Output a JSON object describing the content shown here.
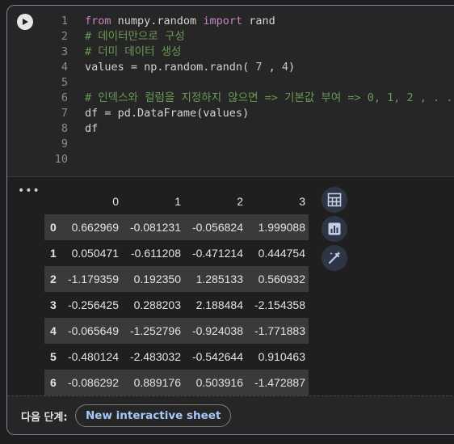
{
  "editor": {
    "lines": [
      {
        "n": "1",
        "segments": [
          {
            "t": "from",
            "c": "kw"
          },
          {
            "t": " numpy.random ",
            "c": ""
          },
          {
            "t": "import",
            "c": "kw"
          },
          {
            "t": " rand",
            "c": ""
          }
        ]
      },
      {
        "n": "2",
        "segments": [
          {
            "t": "# 데이터만으로 구성",
            "c": "cm"
          }
        ]
      },
      {
        "n": "3",
        "segments": [
          {
            "t": "# 더미 데이터 생성",
            "c": "cm"
          }
        ]
      },
      {
        "n": "4",
        "segments": [
          {
            "t": "values = np.random.randn( ",
            "c": ""
          },
          {
            "t": "7",
            "c": "num"
          },
          {
            "t": " , ",
            "c": ""
          },
          {
            "t": "4",
            "c": "num"
          },
          {
            "t": ")",
            "c": ""
          }
        ]
      },
      {
        "n": "5",
        "segments": []
      },
      {
        "n": "6",
        "segments": [
          {
            "t": "# 인덱스와 컬럼을 지정하지 않으면 => 기본값 부여 => 0, 1, 2 , . . .",
            "c": "cm"
          }
        ]
      },
      {
        "n": "7",
        "segments": [
          {
            "t": "df = pd.DataFrame(values)",
            "c": ""
          }
        ]
      },
      {
        "n": "8",
        "segments": [
          {
            "t": "df",
            "c": ""
          }
        ]
      },
      {
        "n": "9",
        "segments": []
      },
      {
        "n": "10",
        "segments": []
      }
    ]
  },
  "output": {
    "menu_label": "•••",
    "columns": [
      "0",
      "1",
      "2",
      "3"
    ],
    "rows": [
      {
        "index": "0",
        "values": [
          "0.662969",
          "-0.081231",
          "-0.056824",
          "1.999088"
        ]
      },
      {
        "index": "1",
        "values": [
          "0.050471",
          "-0.611208",
          "-0.471214",
          "0.444754"
        ]
      },
      {
        "index": "2",
        "values": [
          "-1.179359",
          "0.192350",
          "1.285133",
          "0.560932"
        ]
      },
      {
        "index": "3",
        "values": [
          "-0.256425",
          "0.288203",
          "2.188484",
          "-2.154358"
        ]
      },
      {
        "index": "4",
        "values": [
          "-0.065649",
          "-1.252796",
          "-0.924038",
          "-1.771883"
        ]
      },
      {
        "index": "5",
        "values": [
          "-0.480124",
          "-2.483032",
          "-0.542644",
          "0.910463"
        ]
      },
      {
        "index": "6",
        "values": [
          "-0.086292",
          "0.889176",
          "0.503916",
          "-1.472887"
        ]
      }
    ],
    "side_buttons": [
      {
        "icon": "table-icon"
      },
      {
        "icon": "chart-icon"
      },
      {
        "icon": "magic-wand-icon"
      }
    ]
  },
  "footer": {
    "next_label": "다음 단계:",
    "action_label": "New interactive sheet"
  },
  "colors": {
    "accent": "#a8c7fa",
    "keyword": "#c586c0",
    "comment": "#6a9955",
    "number": "#b5cea8"
  }
}
